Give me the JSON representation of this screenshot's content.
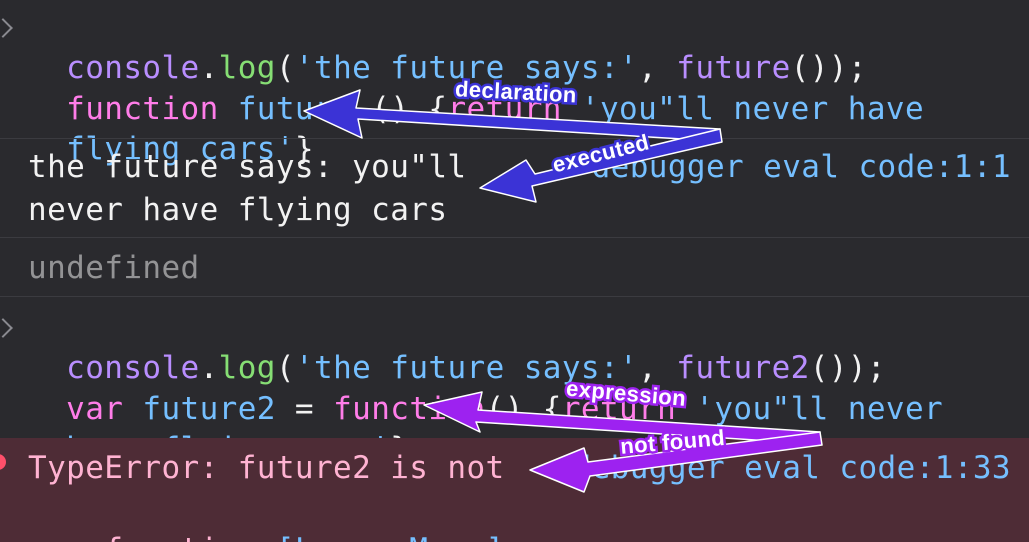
{
  "console": {
    "entry1": {
      "line1": {
        "obj": "console",
        "dot": ".",
        "method": "log",
        "open": "(",
        "str": "'the future says:'",
        "comma": ", ",
        "call": "future",
        "close": "());"
      },
      "line2": {
        "kw": "function",
        "space": " ",
        "name": "future",
        "rest": " () {",
        "ret": "return",
        "str": " 'you\"ll never have"
      },
      "line3": {
        "str": "flying cars'",
        "close": "}"
      }
    },
    "output1": {
      "line1": "the future says: you\"ll",
      "line2": "never have flying cars",
      "location": "debugger eval code:1:1"
    },
    "result1": "undefined",
    "entry2": {
      "line1": {
        "obj": "console",
        "dot": ".",
        "method": "log",
        "open": "(",
        "str": "'the future says:'",
        "comma": ", ",
        "call": "future2",
        "close": "());"
      },
      "line2": {
        "kw": "var",
        "name": " future2",
        "eq": " = ",
        "fn": "function",
        "rest": "() {",
        "ret": "return",
        "str": " 'you\"ll never"
      },
      "line3": {
        "str": "have flying cars'",
        "close": "};"
      }
    },
    "error": {
      "line1": "TypeError: future2 is not",
      "line2_text": "a function ",
      "learn_more": "[Learn More]",
      "location": "debugger eval code:1:33"
    }
  },
  "annotations": {
    "declaration": "declaration",
    "executed": "executed",
    "expression": "expression",
    "not_found": "not found"
  },
  "colors": {
    "background": "#2a2a2e",
    "error_background": "#4e2c36",
    "blue_arrow": "#3b33d6",
    "purple_arrow": "#9d22f0"
  }
}
